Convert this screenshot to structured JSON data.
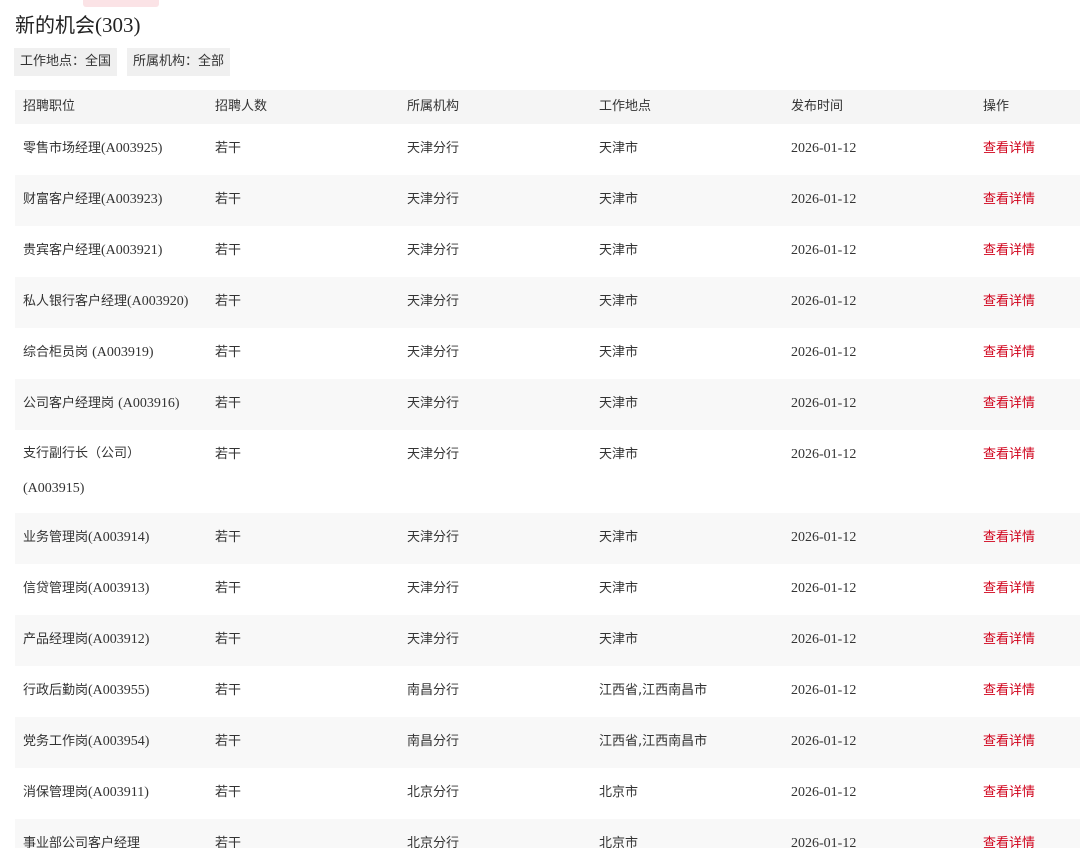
{
  "header": {
    "title": "新的机会",
    "count": "(303)"
  },
  "filters": [
    {
      "label": "工作地点：",
      "value": "全国"
    },
    {
      "label": "所属机构：",
      "value": "全部"
    }
  ],
  "colors": {
    "link": "#d0021b",
    "header_bg": "#f5f5f5",
    "row_alt_bg": "#f8f8f8",
    "chip_bg": "#f0f0f0"
  },
  "table": {
    "columns": [
      "招聘职位",
      "招聘人数",
      "所属机构",
      "工作地点",
      "发布时间",
      "操作"
    ],
    "rows": [
      {
        "position": "零售市场经理",
        "code": "(A003925)",
        "count": "若干",
        "org": "天津分行",
        "location": "天津市",
        "date": "2026-01-12",
        "action": "查看详情"
      },
      {
        "position": "财富客户经理",
        "code": "(A003923)",
        "count": "若干",
        "org": "天津分行",
        "location": "天津市",
        "date": "2026-01-12",
        "action": "查看详情"
      },
      {
        "position": "贵宾客户经理",
        "code": "(A003921)",
        "count": "若干",
        "org": "天津分行",
        "location": "天津市",
        "date": "2026-01-12",
        "action": "查看详情"
      },
      {
        "position": "私人银行客户经理",
        "code": "(A003920)",
        "count": "若干",
        "org": "天津分行",
        "location": "天津市",
        "date": "2026-01-12",
        "action": "查看详情"
      },
      {
        "position": "综合柜员岗 ",
        "code": "(A003919)",
        "count": "若干",
        "org": "天津分行",
        "location": "天津市",
        "date": "2026-01-12",
        "action": "查看详情"
      },
      {
        "position": "公司客户经理岗 ",
        "code": "(A003916)",
        "count": "若干",
        "org": "天津分行",
        "location": "天津市",
        "date": "2026-01-12",
        "action": "查看详情"
      },
      {
        "position": "支行副行长（公司）",
        "code": "(A003915)",
        "count": "若干",
        "org": "天津分行",
        "location": "天津市",
        "date": "2026-01-12",
        "action": "查看详情"
      },
      {
        "position": "业务管理岗",
        "code": "(A003914)",
        "count": "若干",
        "org": "天津分行",
        "location": "天津市",
        "date": "2026-01-12",
        "action": "查看详情"
      },
      {
        "position": "信贷管理岗",
        "code": "(A003913)",
        "count": "若干",
        "org": "天津分行",
        "location": "天津市",
        "date": "2026-01-12",
        "action": "查看详情"
      },
      {
        "position": "产品经理岗",
        "code": "(A003912)",
        "count": "若干",
        "org": "天津分行",
        "location": "天津市",
        "date": "2026-01-12",
        "action": "查看详情"
      },
      {
        "position": "行政后勤岗",
        "code": "(A003955)",
        "count": "若干",
        "org": "南昌分行",
        "location": "江西省,江西南昌市",
        "date": "2026-01-12",
        "action": "查看详情"
      },
      {
        "position": "党务工作岗",
        "code": "(A003954)",
        "count": "若干",
        "org": "南昌分行",
        "location": "江西省,江西南昌市",
        "date": "2026-01-12",
        "action": "查看详情"
      },
      {
        "position": "消保管理岗",
        "code": "(A003911)",
        "count": "若干",
        "org": "北京分行",
        "location": "北京市",
        "date": "2026-01-12",
        "action": "查看详情"
      },
      {
        "position": "事业部公司客户经理",
        "code": "",
        "count": "若干",
        "org": "北京分行",
        "location": "北京市",
        "date": "2026-01-12",
        "action": "查看详情"
      }
    ]
  }
}
